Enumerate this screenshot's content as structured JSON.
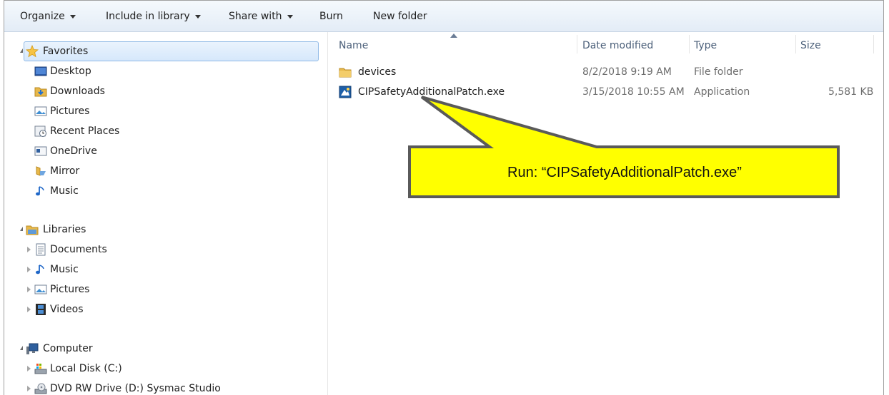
{
  "toolbar": {
    "organize": "Organize",
    "include_in_library": "Include in library",
    "share_with": "Share with",
    "burn": "Burn",
    "new_folder": "New folder"
  },
  "nav": {
    "favorites": {
      "label": "Favorites",
      "items": [
        "Desktop",
        "Downloads",
        "Pictures",
        "Recent Places",
        "OneDrive",
        "Mirror",
        "Music"
      ]
    },
    "libraries": {
      "label": "Libraries",
      "items": [
        "Documents",
        "Music",
        "Pictures",
        "Videos"
      ]
    },
    "computer": {
      "label": "Computer",
      "items": [
        "Local Disk (C:)",
        "DVD RW Drive (D:) Sysmac Studio"
      ]
    }
  },
  "columns": {
    "name": "Name",
    "date_modified": "Date modified",
    "type": "Type",
    "size": "Size"
  },
  "files": [
    {
      "name": "devices",
      "date": "8/2/2018 9:19 AM",
      "type": "File folder",
      "size": "",
      "icon": "folder-icon"
    },
    {
      "name": "CIPSafetyAdditionalPatch.exe",
      "date": "3/15/2018 10:55 AM",
      "type": "Application",
      "size": "5,581 KB",
      "icon": "application-icon"
    }
  ],
  "callout": {
    "text": "Run: “CIPSafetyAdditionalPatch.exe”",
    "fill": "#ffff00",
    "stroke": "#5a5a5a"
  },
  "colors": {
    "header_text": "#4c607a",
    "selection_border": "#8fb9e6"
  }
}
